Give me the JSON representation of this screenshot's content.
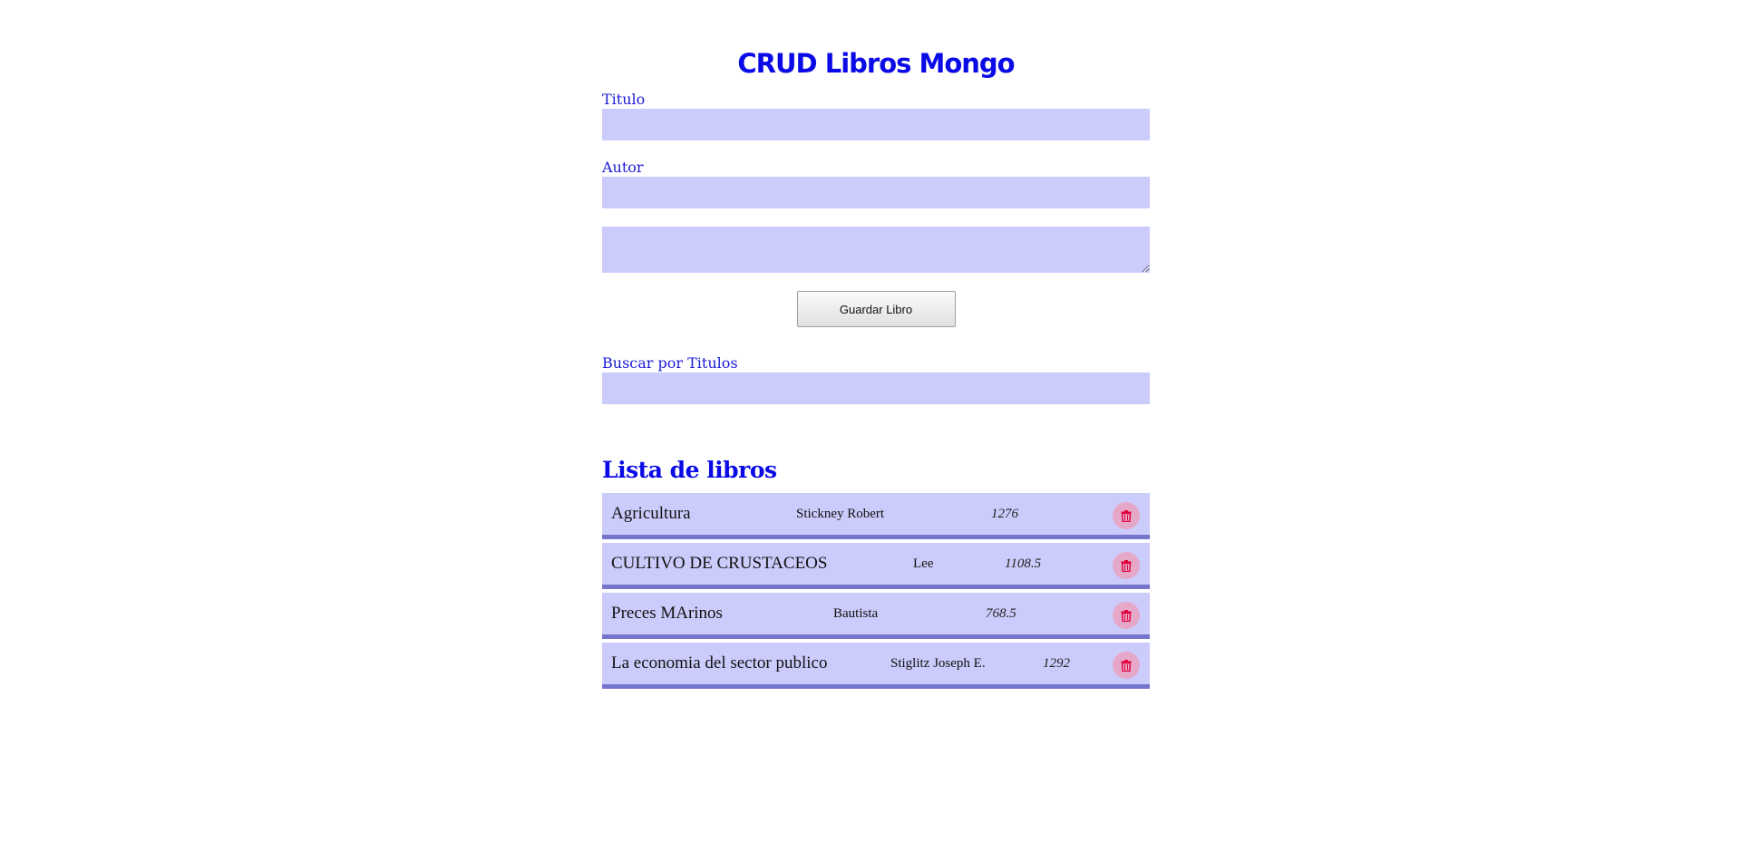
{
  "header": {
    "title": "CRUD Libros Mongo"
  },
  "form": {
    "titulo_label": "Titulo",
    "titulo_value": "",
    "autor_label": "Autor",
    "autor_value": "",
    "textarea_value": "",
    "save_label": "Guardar Libro",
    "search_label": "Buscar por Titulos",
    "search_value": ""
  },
  "list": {
    "title": "Lista de libros",
    "books": [
      {
        "title": "Agricultura",
        "author": "Stickney Robert",
        "number": "1276"
      },
      {
        "title": "CULTIVO DE CRUSTACEOS",
        "author": "Lee",
        "number": "1108.5"
      },
      {
        "title": "Preces MArinos",
        "author": "Bautista",
        "number": "768.5"
      },
      {
        "title": "La economia del sector publico",
        "author": "Stiglitz Joseph E.",
        "number": "1292"
      }
    ],
    "delete_icon": "trash-icon"
  },
  "colors": {
    "accent": "#0a0ae6",
    "input_bg": "#ccccfc",
    "row_border": "#7575cc",
    "delete_bg": "#e6a8c8",
    "delete_icon": "#e0003c"
  }
}
